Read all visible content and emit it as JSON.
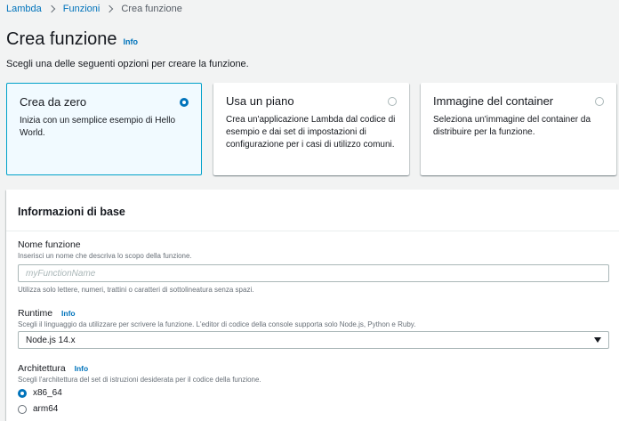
{
  "breadcrumb": {
    "items": [
      "Lambda",
      "Funzioni"
    ],
    "current": "Crea funzione"
  },
  "header": {
    "title": "Crea funzione",
    "info": "Info",
    "subtitle": "Scegli una delle seguenti opzioni per creare la funzione."
  },
  "options": [
    {
      "title": "Crea da zero",
      "description": "Inizia con un semplice esempio di Hello World.",
      "selected": true
    },
    {
      "title": "Usa un piano",
      "description": "Crea un'applicazione Lambda dal codice di esempio e dai set di impostazioni di configurazione per i casi di utilizzo comuni.",
      "selected": false
    },
    {
      "title": "Immagine del container",
      "description": "Seleziona un'immagine del container da distribuire per la funzione.",
      "selected": false
    }
  ],
  "basic_info": {
    "title": "Informazioni di base",
    "function_name": {
      "label": "Nome funzione",
      "description": "Inserisci un nome che descriva lo scopo della funzione.",
      "placeholder": "myFunctionName",
      "value": "",
      "hint": "Utilizza solo lettere, numeri, trattini o caratteri di sottolineatura senza spazi."
    },
    "runtime": {
      "label": "Runtime",
      "info": "Info",
      "description": "Scegli il linguaggio da utilizzare per scrivere la funzione. L'editor di codice della console supporta solo Node.js, Python e Ruby.",
      "value": "Node.js 14.x"
    },
    "architecture": {
      "label": "Architettura",
      "info": "Info",
      "description": "Scegli l'architettura del set di istruzioni desiderata per il codice della funzione.",
      "options": [
        {
          "label": "x86_64",
          "selected": true
        },
        {
          "label": "arm64",
          "selected": false
        }
      ]
    }
  },
  "colors": {
    "link": "#0073bb",
    "selected_border": "#00a1c9",
    "selected_bg": "#f1faff",
    "page_bg": "#f2f3f3"
  }
}
